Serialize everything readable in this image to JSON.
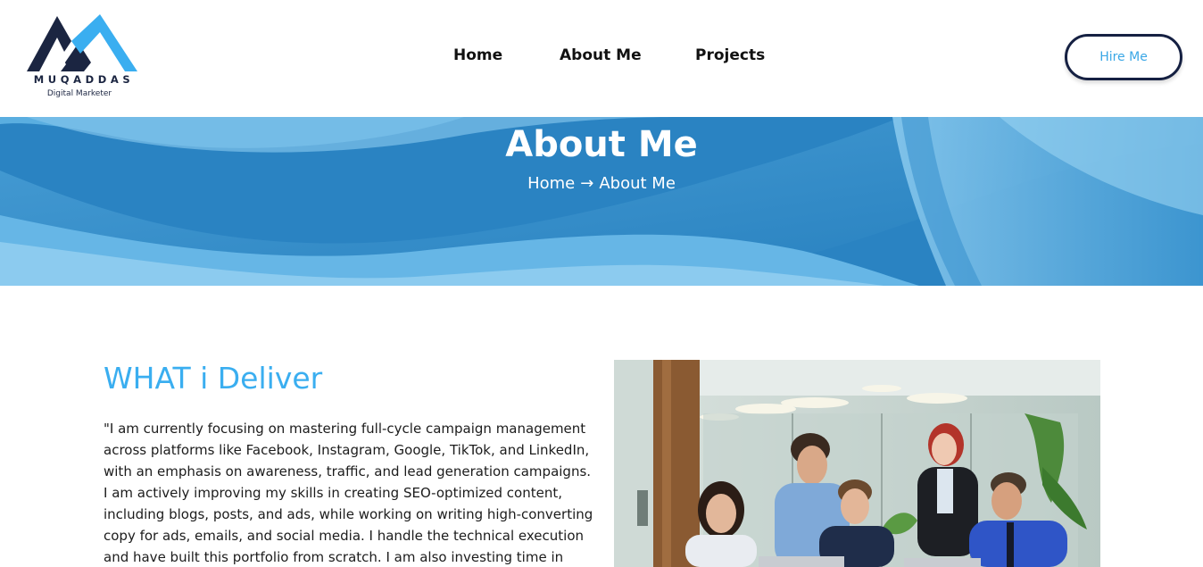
{
  "logo": {
    "name": "MUQADDAS",
    "tagline": "Digital Marketer",
    "colors": {
      "dark": "#1b2541",
      "accent": "#3aaef0"
    }
  },
  "nav": {
    "items": [
      {
        "label": "Home"
      },
      {
        "label": "About Me"
      },
      {
        "label": "Projects"
      }
    ],
    "cta_label": "Hire Me"
  },
  "banner": {
    "title": "About Me",
    "breadcrumb": {
      "home": "Home",
      "separator": "→",
      "current": "About Me"
    }
  },
  "about": {
    "heading": "WHAT i Deliver",
    "paragraph": "\"I am currently focusing on mastering full-cycle campaign management across platforms like Facebook, Instagram, Google, TikTok, and LinkedIn, with an emphasis on awareness, traffic, and lead generation campaigns. I am actively improving my skills in creating SEO-optimized content, including blogs, posts, and ads, while working on writing high-converting copy for ads, emails, and social media. I handle the technical execution and have built this portfolio from scratch. I am also investing time in expanding my knowledge"
  },
  "colors": {
    "accent": "#3aaef0",
    "navy": "#152042",
    "banner": "#2d86c4"
  }
}
